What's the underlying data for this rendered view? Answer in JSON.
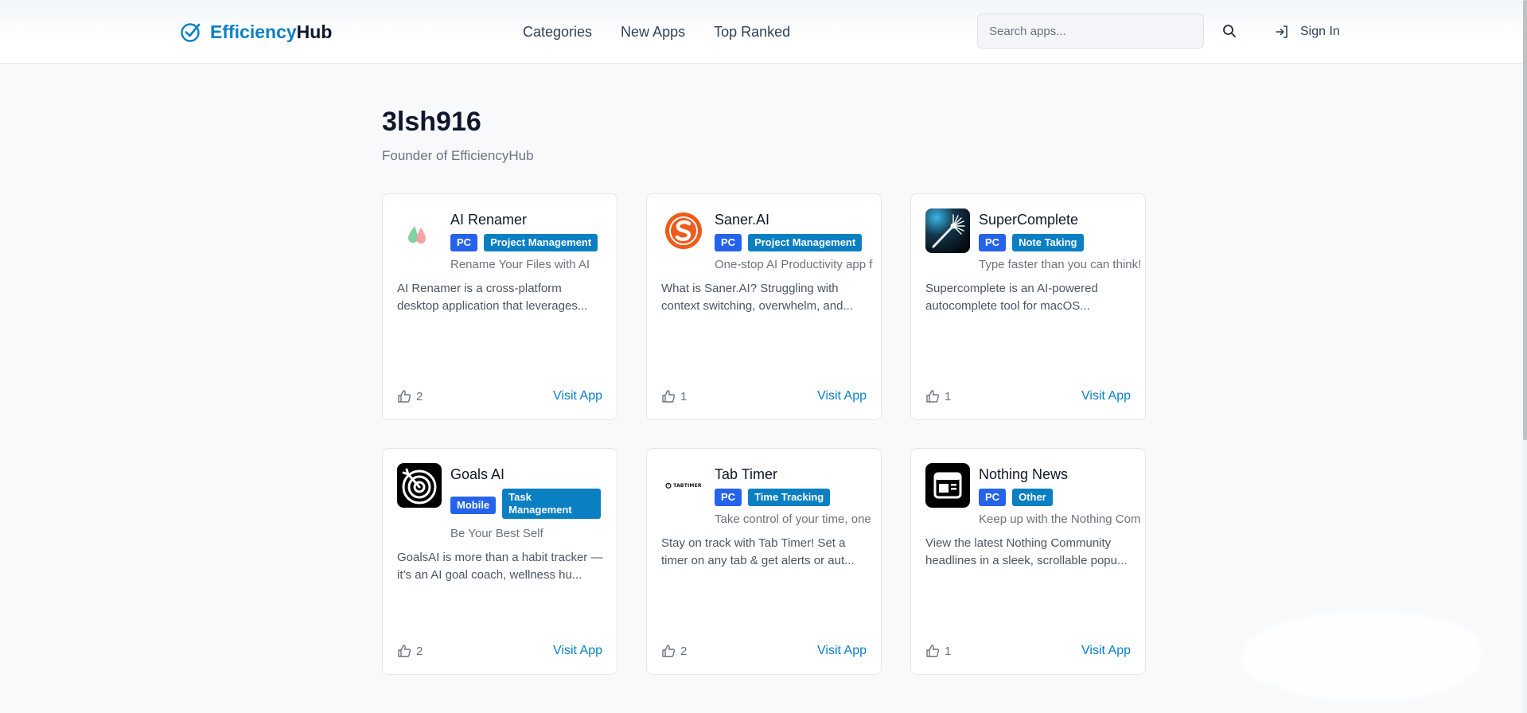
{
  "header": {
    "logo_part1": "Efficiency",
    "logo_part2": "Hub",
    "nav": [
      "Categories",
      "New Apps",
      "Top Ranked"
    ],
    "search_placeholder": "Search apps...",
    "sign_in": "Sign In"
  },
  "profile": {
    "name": "3lsh916",
    "role": "Founder of EfficiencyHub"
  },
  "apps": [
    {
      "title": "AI Renamer",
      "platform": "PC",
      "category": "Project Management",
      "tagline": "Rename Your Files with AI",
      "description": "AI Renamer is a cross-platform desktop application that leverages...",
      "likes": "2",
      "visit": "Visit App",
      "icon": "drops-icon"
    },
    {
      "title": "Saner.AI",
      "platform": "PC",
      "category": "Project Management",
      "tagline": "One-stop AI Productivity app f",
      "description": "What is Saner.AI? Struggling with context switching, overwhelm, and...",
      "likes": "1",
      "visit": "Visit App",
      "icon": "saner-s-icon"
    },
    {
      "title": "SuperComplete",
      "platform": "PC",
      "category": "Note Taking",
      "tagline": "Type faster than you can think!",
      "description": "Supercomplete is an AI-powered autocomplete tool for macOS...",
      "likes": "1",
      "visit": "Visit App",
      "icon": "sparkle-wand-icon"
    },
    {
      "title": "Goals AI",
      "platform": "Mobile",
      "category": "Task Management",
      "tagline": "Be Your Best Self",
      "description": "GoalsAI is more than a habit tracker — it’s an AI goal coach, wellness hu...",
      "likes": "2",
      "visit": "Visit App",
      "icon": "target-icon"
    },
    {
      "title": "Tab Timer",
      "platform": "PC",
      "category": "Time Tracking",
      "tagline": "Take control of your time, one",
      "description": "Stay on track with Tab Timer! Set a timer on any tab & get alerts or aut...",
      "likes": "2",
      "visit": "Visit App",
      "icon": "tabtimer-logo-icon",
      "icon_text": "TABTIMER"
    },
    {
      "title": "Nothing News",
      "platform": "PC",
      "category": "Other",
      "tagline": "Keep up with the Nothing Com",
      "description": "View the latest Nothing Community headlines in a sleek, scrollable popu...",
      "likes": "1",
      "visit": "Visit App",
      "icon": "newspaper-icon"
    }
  ],
  "colors": {
    "brand": "#0a80c5",
    "platform_tag": "#2563eb",
    "category_tag": "#0a7fc2",
    "saner_orange": "#f05a1a"
  }
}
